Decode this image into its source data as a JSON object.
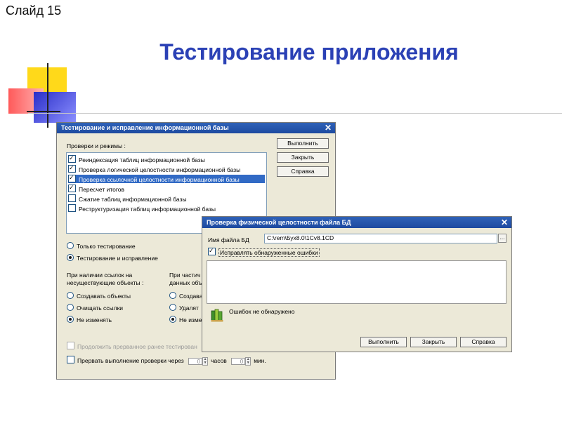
{
  "slide": {
    "number_label": "Слайд 15",
    "title": "Тестирование приложения"
  },
  "colors": {
    "title": "#2b41b5",
    "dialog_bg": "#ece9d8",
    "titlebar": "#1d4aa0",
    "selection": "#316ac5"
  },
  "main_dialog": {
    "title": "Тестирование и исправление информационной базы",
    "close": "✕",
    "checks_label": "Проверки и режимы :",
    "checks": [
      {
        "label": "Реиндексация таблиц информационной базы",
        "checked": true
      },
      {
        "label": "Проверка логической целостности информационной базы",
        "checked": true
      },
      {
        "label": "Проверка ссылочной целостности информационной базы",
        "checked": true,
        "selected": true
      },
      {
        "label": "Пересчет итогов",
        "checked": true
      },
      {
        "label": "Сжатие таблиц информационной базы",
        "checked": false
      },
      {
        "label": "Реструктуризация таблиц информационной базы",
        "checked": false
      }
    ],
    "buttons": {
      "run": "Выполнить",
      "close": "Закрыть",
      "help": "Справка"
    },
    "mode_only_test": "Только тестирование",
    "mode_test_fix": "Тестирование и исправление",
    "refs_heading_1": "При наличии ссылок на",
    "refs_heading_2": "несуществующие объекты :",
    "partial_heading_1": "При частич",
    "partial_heading_2": "данных объ",
    "refs_opt_create": "Создавать объекты",
    "refs_opt_clear": "Очищать ссылки",
    "refs_opt_nochange": "Не изменять",
    "partial_opt_create": "Создава",
    "partial_opt_delete": "Удалят",
    "partial_opt_nochange": "Не изме",
    "continue_label": "Продолжить прерванное ранее тестирован",
    "interrupt_label": "Прервать выполнение проверки через",
    "hours_value": "0",
    "hours_unit": "часов",
    "minutes_value": "0",
    "minutes_unit": "мин."
  },
  "sub_dialog": {
    "title": "Проверка физической целостности файла БД",
    "close": "✕",
    "db_file_label": "Имя файла БД",
    "db_file_value": "C:\\rem\\Бух8.0\\1Cv8.1CD",
    "browse": "...",
    "fix_errors_label": "Исправлять обнаруженные ошибки",
    "fix_errors_checked": true,
    "result_text": "Ошибок не обнаружено",
    "result_icon": "books-icon",
    "buttons": {
      "run": "Выполнить",
      "close": "Закрыть",
      "help": "Справка"
    }
  }
}
